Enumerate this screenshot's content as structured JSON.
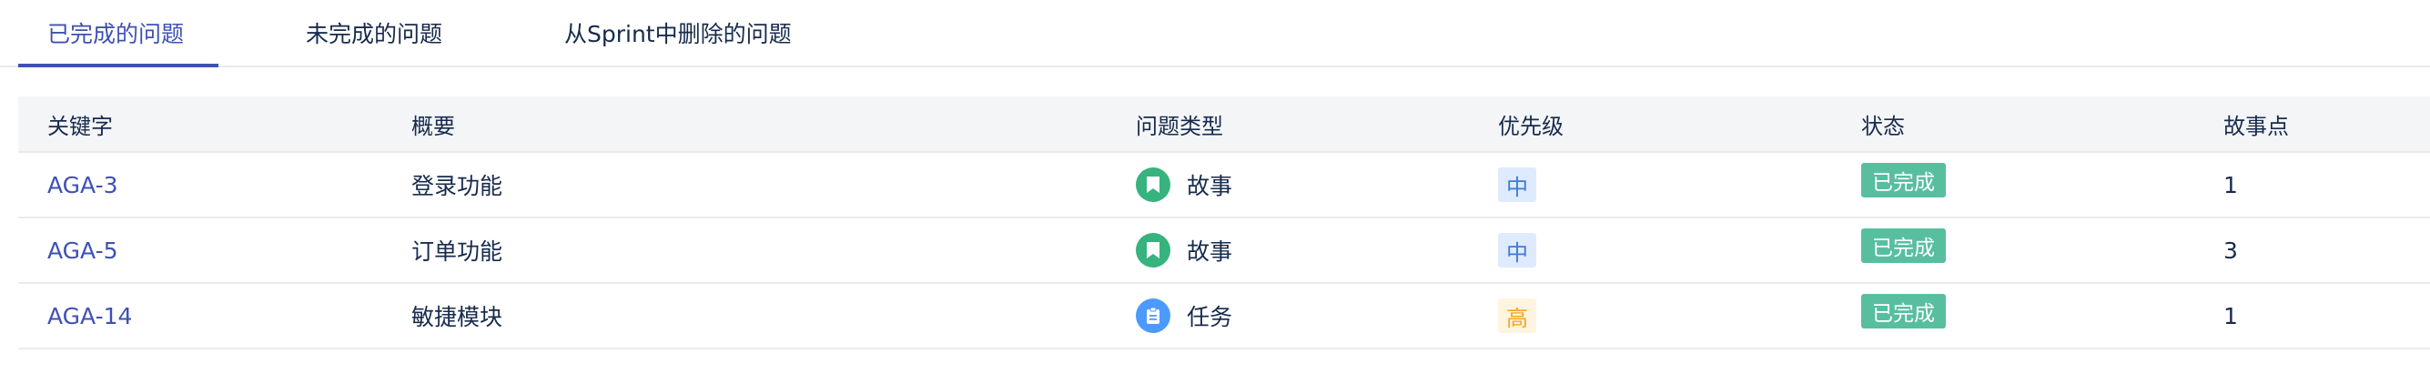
{
  "tabs": [
    {
      "label": "已完成的问题",
      "active": true
    },
    {
      "label": "未完成的问题",
      "active": false
    },
    {
      "label": "从Sprint中删除的问题",
      "active": false
    }
  ],
  "columns": [
    "关键字",
    "概要",
    "问题类型",
    "优先级",
    "状态",
    "故事点"
  ],
  "rows": [
    {
      "key": "AGA-3",
      "summary": "登录功能",
      "type": "故事",
      "type_icon": "bookmark-icon",
      "priority": "中",
      "status": "已完成",
      "points": "1"
    },
    {
      "key": "AGA-5",
      "summary": "订单功能",
      "type": "故事",
      "type_icon": "bookmark-icon",
      "priority": "中",
      "status": "已完成",
      "points": "3"
    },
    {
      "key": "AGA-14",
      "summary": "敏捷模块",
      "type": "任务",
      "type_icon": "clipboard-icon",
      "priority": "高",
      "status": "已完成",
      "points": "1"
    }
  ],
  "colors": {
    "accent": "#3f51b5",
    "story": "#36b37e",
    "task": "#4c9aff",
    "status_done": "#57bfa0",
    "priority_medium_bg": "#deebff",
    "priority_medium_text": "#3f7ad9",
    "priority_high_bg": "#fff4e0",
    "priority_high_text": "#f6a623"
  }
}
